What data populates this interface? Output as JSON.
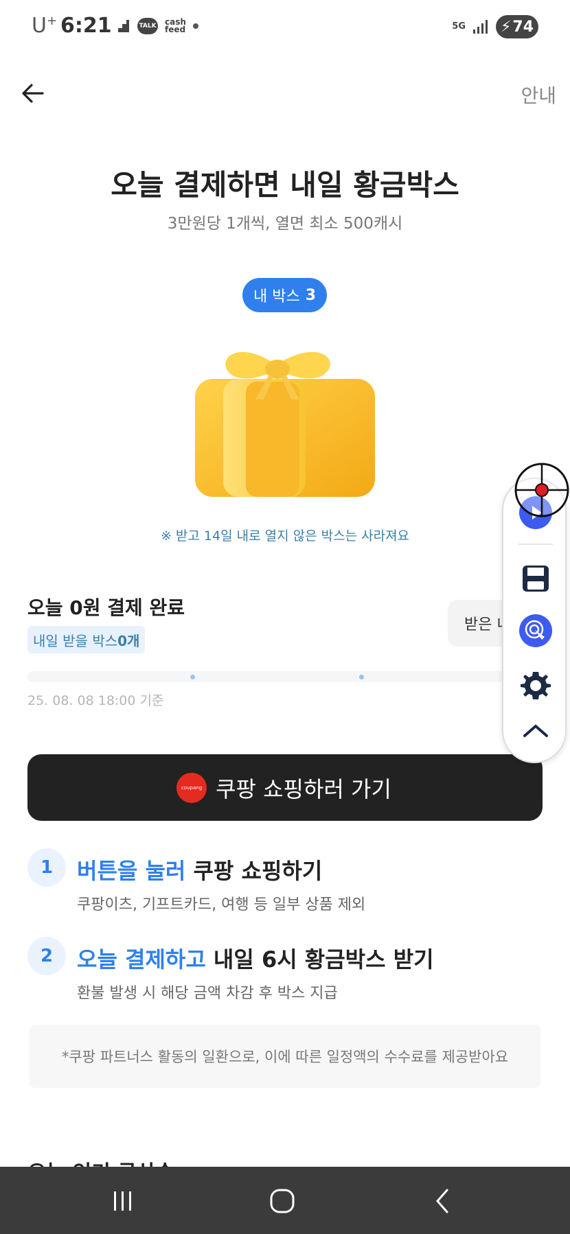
{
  "status_bar": {
    "carrier": "U",
    "carrier_sup": "+",
    "time": "6:21",
    "talk_icon_text": "TALK",
    "cash_icon_text": "cash\nfeed",
    "network": "5G",
    "battery": "74"
  },
  "nav": {
    "back_icon": "arrow-left-icon",
    "guide_label": "안내"
  },
  "hero": {
    "title": "오늘 결제하면 내일 황금박스",
    "subtitle": "3만원당 1개씩, 열면 최소 500캐시"
  },
  "my_box": {
    "label": "내 박스",
    "count": "3"
  },
  "gift_icon": "gift-box-icon",
  "expiry_note": "※ 받고 14일 내로 열지 않은 박스는 사라져요",
  "payment": {
    "status": "오늘 0원 결제 완료",
    "tomorrow_prefix": "내일 받을 박스 ",
    "tomorrow_count": "0개",
    "received_chip": "받은 내",
    "progress_fraction": 0,
    "timestamp": "25. 08. 08 18:00 기준"
  },
  "cta": {
    "logo_text": "coupang",
    "label": "쿠팡 쇼핑하러 가기"
  },
  "steps": [
    {
      "num": "1",
      "highlight": "버튼을 눌러",
      "title_rest": " 쿠팡 쇼핑하기",
      "desc": "쿠팡이츠, 기프트카드, 여행 등 일부 상품 제외"
    },
    {
      "num": "2",
      "highlight": "오늘 결제하고",
      "title_rest": " 내일 6시 황금박스 받기",
      "desc": "환불 발생 시 해당 금액 차감 후 박스 지급"
    }
  ],
  "disclaimer": "*쿠팡 파트너스 활동의 일환으로, 이에 따른 일정액의 수수료를 제공받아요",
  "cutoff_heading": "오늘 인기 급상승",
  "colors": {
    "accent": "#2f80ed",
    "cta_bg": "#222222",
    "gift_yellow": "#f9c02e",
    "coupang_red": "#e52b20"
  },
  "floating_toolbar": [
    "play-icon",
    "save-icon",
    "touch-icon",
    "gear-icon",
    "chevron-up-icon",
    "crosshair-icon"
  ],
  "system_nav": [
    "recents-icon",
    "home-icon",
    "back-icon"
  ]
}
